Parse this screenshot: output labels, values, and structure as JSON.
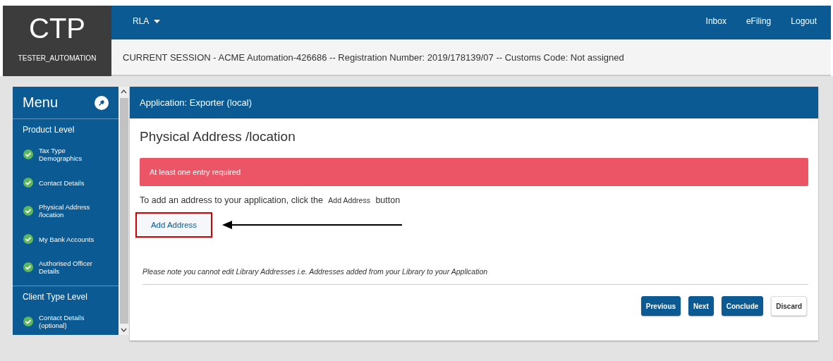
{
  "brand": {
    "logo": "CTP",
    "user": "TESTER_AUTOMATION"
  },
  "nav": {
    "dropdown": "RLA",
    "links": [
      "Inbox",
      "eFiling",
      "Logout"
    ]
  },
  "session": "CURRENT SESSION - ACME Automation-426686 -- Registration Number: 2019/178139/07 -- Customs Code: Not assigned",
  "sidebar": {
    "title": "Menu",
    "sections": [
      {
        "heading": "Product Level",
        "items": [
          {
            "label": "Tax Type Demographics",
            "done": true
          },
          {
            "label": "Contact Details",
            "done": true
          },
          {
            "label": "Physical Address /location",
            "done": true
          },
          {
            "label": "My Bank Accounts",
            "done": true
          },
          {
            "label": "Authorised Officer Details",
            "done": true
          }
        ]
      },
      {
        "heading": "Client Type Level",
        "items": [
          {
            "label": "Contact Details (optional)",
            "done": true
          }
        ]
      }
    ]
  },
  "panel": {
    "title": "Application: Exporter (local)",
    "heading": "Physical Address /location",
    "alert": "At least one entry required",
    "instruction": {
      "before": "To add an address to your application, click the",
      "button_ref": "Add Address",
      "after": "button"
    },
    "add_button": "Add Address",
    "highlighted": true,
    "note": "Please note  you cannot edit Library Addresses i.e. Addresses added from your Library to your Application",
    "actions": [
      {
        "label": "Previous",
        "kind": "primary"
      },
      {
        "label": "Next",
        "kind": "primary"
      },
      {
        "label": "Conclude",
        "kind": "primary"
      },
      {
        "label": "Discard",
        "kind": "plain"
      }
    ]
  }
}
